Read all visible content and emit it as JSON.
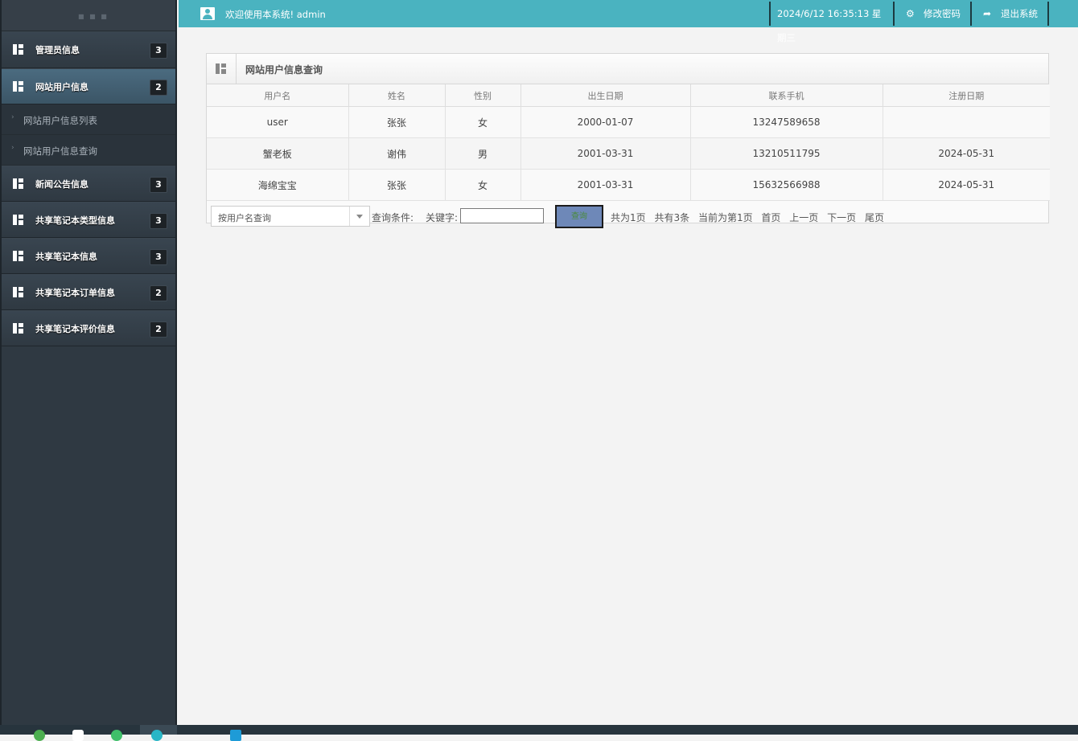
{
  "sidebar": {
    "items": [
      {
        "label": "管理员信息",
        "badge": "3"
      },
      {
        "label": "网站用户信息",
        "badge": "2"
      },
      {
        "label": "新闻公告信息",
        "badge": "3"
      },
      {
        "label": "共享笔记本类型信息",
        "badge": "3"
      },
      {
        "label": "共享笔记本信息",
        "badge": "3"
      },
      {
        "label": "共享笔记本订单信息",
        "badge": "2"
      },
      {
        "label": "共享笔记本评价信息",
        "badge": "2"
      }
    ],
    "subitems": [
      {
        "label": "网站用户信息列表"
      },
      {
        "label": "网站用户信息查询"
      }
    ]
  },
  "header": {
    "welcome": "欢迎使用本系统! admin",
    "datetime": "2024/6/12 16:35:13 星期三",
    "change_password": "修改密码",
    "logout": "退出系统"
  },
  "panel": {
    "title": "网站用户信息查询",
    "columns": [
      "用户名",
      "姓名",
      "性别",
      "出生日期",
      "联系手机",
      "注册日期"
    ],
    "rows": [
      [
        "user",
        "张张",
        "女",
        "2000-01-07",
        "13247589658",
        ""
      ],
      [
        "蟹老板",
        "谢伟",
        "男",
        "2001-03-31",
        "13210511795",
        "2024-05-31"
      ],
      [
        "海绵宝宝",
        "张张",
        "女",
        "2001-03-31",
        "15632566988",
        "2024-05-31"
      ]
    ]
  },
  "search": {
    "field_selected": "按用户名查询",
    "condition_label": "查询条件:",
    "keyword_label": "关键字:",
    "keyword_value": "",
    "button": "查询"
  },
  "pager": {
    "total_pages": "共为1页",
    "total_records": "共有3条",
    "current_page": "当前为第1页",
    "first": "首页",
    "prev": "上一页",
    "next": "下一页",
    "last": "尾页"
  },
  "colors": {
    "topbar": "#4ab3c0",
    "sidebar": "#2f3942",
    "active_item": "#4b6b80",
    "search_button": "#6e88b8"
  }
}
